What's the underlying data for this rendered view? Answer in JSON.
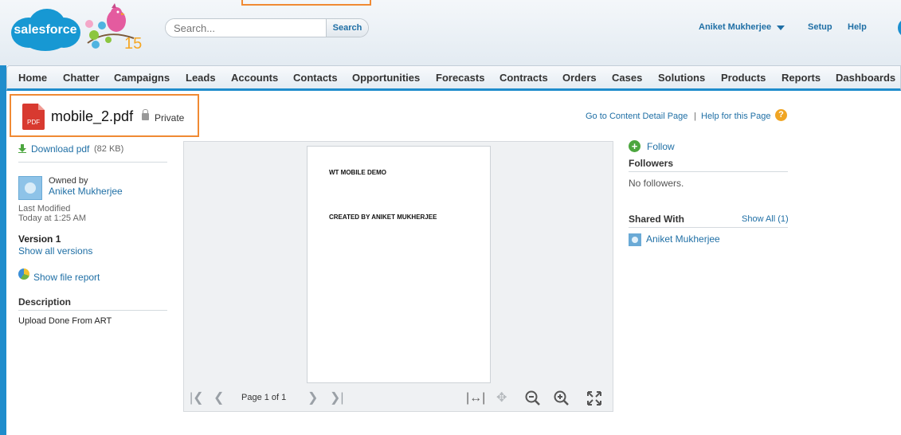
{
  "header": {
    "logo_text": "salesforce",
    "anniversary_badge": "15",
    "search": {
      "placeholder": "Search...",
      "button_label": "Search"
    },
    "user_name": "Aniket Mukherjee",
    "setup_label": "Setup",
    "help_label": "Help"
  },
  "nav": {
    "tabs": [
      "Home",
      "Chatter",
      "Campaigns",
      "Leads",
      "Accounts",
      "Contacts",
      "Opportunities",
      "Forecasts",
      "Contracts",
      "Orders",
      "Cases",
      "Solutions",
      "Products",
      "Reports",
      "Dashboards"
    ]
  },
  "file": {
    "icon_label": "PDF",
    "title": "mobile_2.pdf",
    "visibility": "Private",
    "go_to_detail_label": "Go to Content Detail Page",
    "separator": "|",
    "help_page_label": "Help for this Page",
    "help_icon": "?"
  },
  "left_panel": {
    "download_label": "Download pdf",
    "download_size": "(82 KB)",
    "owned_by_label": "Owned by",
    "owner_name": "Aniket Mukherjee",
    "last_modified_label": "Last Modified",
    "last_modified_value": "Today at 1:25 AM",
    "version_label": "Version 1",
    "show_versions_label": "Show all versions",
    "file_report_label": "Show file report",
    "description_heading": "Description",
    "description_text": "Upload Done From ART"
  },
  "viewer": {
    "page_lines": [
      "WT MOBILE DEMO",
      "CREATED BY ANIKET MUKHERJEE"
    ],
    "page_indicator": "Page 1 of 1"
  },
  "right_panel": {
    "follow_label": "Follow",
    "followers_heading": "Followers",
    "no_followers_text": "No followers.",
    "shared_with_heading": "Shared With",
    "show_all_label": "Show All (1)",
    "shared_user": "Aniket Mukherjee"
  },
  "colors": {
    "brand_blue": "#1f8dcc",
    "link_blue": "#1f6fa5",
    "highlight_orange": "#f08a33",
    "pdf_red": "#d83a30"
  }
}
